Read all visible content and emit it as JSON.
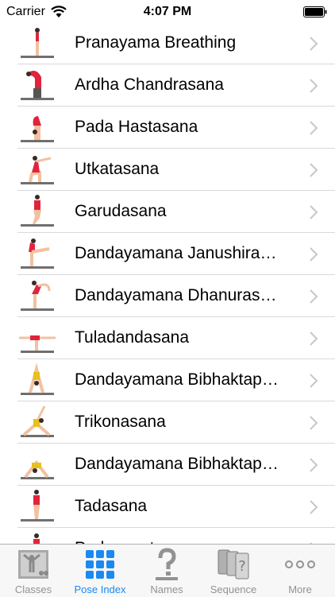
{
  "status_bar": {
    "carrier": "Carrier",
    "time": "4:07 PM"
  },
  "poses": [
    {
      "name": "Pranayama Breathing"
    },
    {
      "name": "Ardha Chandrasana"
    },
    {
      "name": "Pada Hastasana"
    },
    {
      "name": "Utkatasana"
    },
    {
      "name": "Garudasana"
    },
    {
      "name": "Dandayamana Janushira…"
    },
    {
      "name": "Dandayamana Dhanuras…"
    },
    {
      "name": "Tuladandasana"
    },
    {
      "name": "Dandayamana Bibhaktap…"
    },
    {
      "name": "Trikonasana"
    },
    {
      "name": "Dandayamana Bibhaktap…"
    },
    {
      "name": "Tadasana"
    },
    {
      "name": "Padangustasana"
    }
  ],
  "tabs": [
    {
      "label": "Classes",
      "icon": "classes-icon",
      "active": false
    },
    {
      "label": "Pose Index",
      "icon": "grid-icon",
      "active": true
    },
    {
      "label": "Names",
      "icon": "question-icon",
      "active": false
    },
    {
      "label": "Sequence",
      "icon": "sequence-cards-icon",
      "active": false
    },
    {
      "label": "More",
      "icon": "more-dots-icon",
      "active": false
    }
  ],
  "colors": {
    "accent": "#1a8af2",
    "inactive": "#929292",
    "separator": "#d9d9de",
    "chevron": "#c7c7cc"
  }
}
